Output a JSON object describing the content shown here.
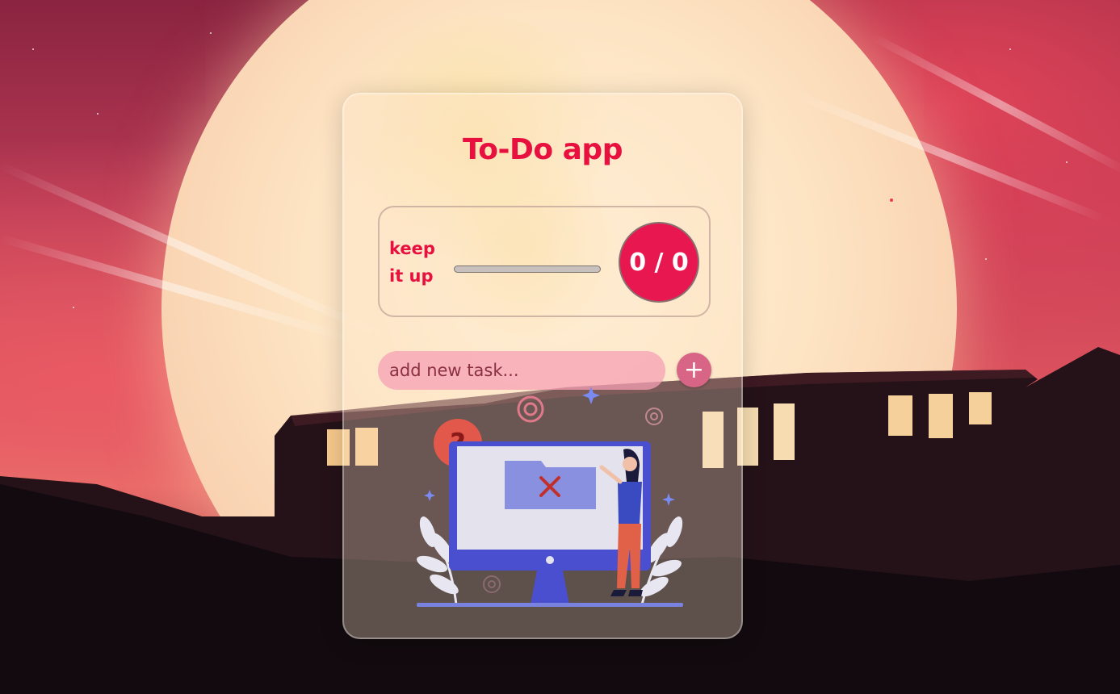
{
  "app": {
    "title": "To-Do app"
  },
  "progress": {
    "motivation": "keep it up",
    "completed": 0,
    "total": 0,
    "counter_text": "0 / 0",
    "fraction_complete": 0
  },
  "task_input": {
    "placeholder": "add new task...",
    "value": ""
  },
  "add_button": {
    "label": "+"
  },
  "colors": {
    "accent": "#e8103e",
    "counter_bg": "#e8174f",
    "input_bg": "#f5a0b4",
    "add_button_bg": "#d86585"
  },
  "icons": {
    "add": "plus-icon",
    "illustration": "empty-tasks-illustration"
  }
}
